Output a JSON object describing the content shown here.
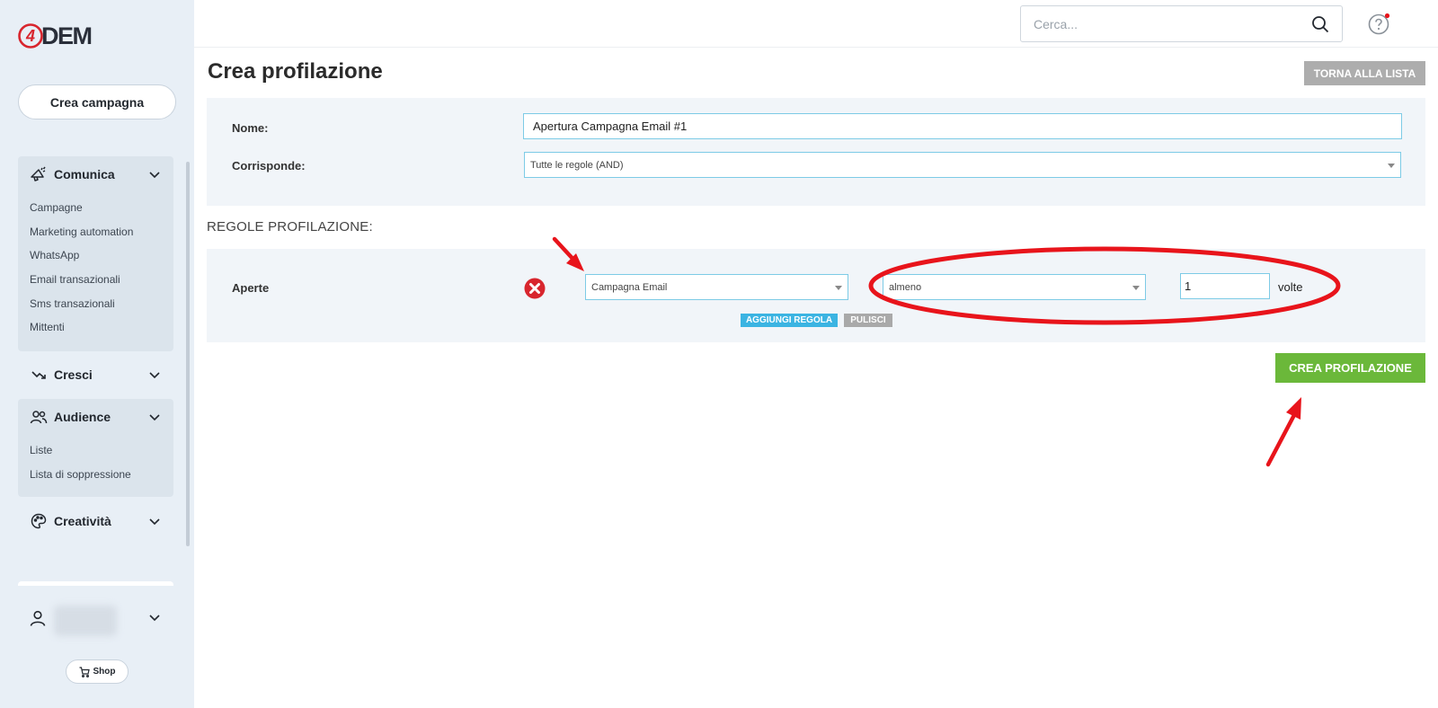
{
  "logo": {
    "number": "4",
    "text": "DEM"
  },
  "sidebar": {
    "create_campaign": "Crea campagna",
    "groups": [
      {
        "label": "Comunica",
        "icon": "megaphone-icon",
        "items": [
          "Campagne",
          "Marketing automation",
          "WhatsApp",
          "Email transazionali",
          "Sms transazionali",
          "Mittenti"
        ]
      },
      {
        "label": "Cresci",
        "icon": "trending-up-icon",
        "items": []
      },
      {
        "label": "Audience",
        "icon": "users-icon",
        "items": [
          "Liste",
          "Lista di soppressione"
        ]
      },
      {
        "label": "Creatività",
        "icon": "palette-icon",
        "items": []
      }
    ],
    "shop": "Shop"
  },
  "topbar": {
    "search_placeholder": "Cerca..."
  },
  "page": {
    "title": "Crea profilazione",
    "back_button": "TORNA ALLA LISTA",
    "name_label": "Nome:",
    "name_value": "Apertura Campagna Email #1",
    "match_label": "Corrisponde:",
    "match_value": "Tutte le regole (AND)",
    "rules_title": "REGOLE PROFILAZIONE:",
    "rule": {
      "label": "Aperte",
      "source": "Campagna Email",
      "operator": "almeno",
      "count": "1",
      "unit": "volte"
    },
    "add_rule": "AGGIUNGI REGOLA",
    "clear": "PULISCI",
    "create_button": "CREA PROFILAZIONE"
  },
  "colors": {
    "sidebar_bg": "#e8eff6",
    "panel_bg": "#f1f5f9",
    "field_border": "#7dcbe6",
    "primary_green": "#6bb83a",
    "info_blue": "#3bb4e2",
    "annotation_red": "#e8141b"
  }
}
